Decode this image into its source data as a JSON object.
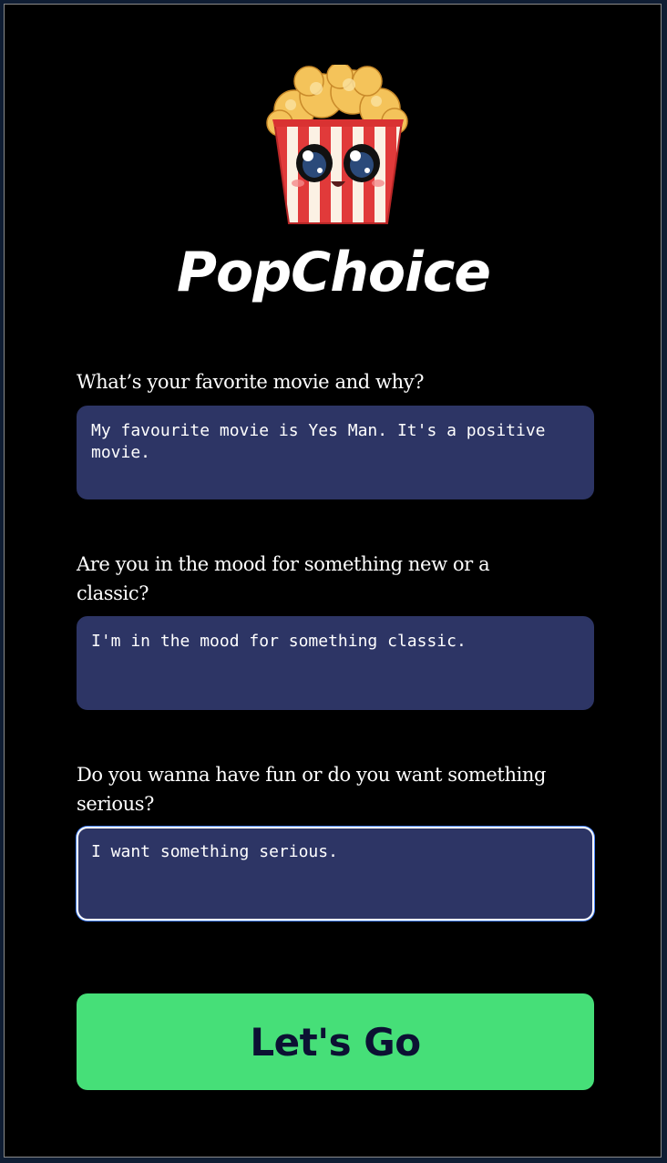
{
  "app": {
    "title": "PopChoice",
    "logo_icon": "popcorn-mascot-icon"
  },
  "form": {
    "questions": [
      {
        "label": "What’s your favorite movie and why?",
        "answer": "My favourite movie is Yes Man. It's a positive movie."
      },
      {
        "label": "Are you in the mood for something new or a classic?",
        "answer": "I'm in the mood for something classic."
      },
      {
        "label": "Do you wanna have fun or do you want something serious?",
        "answer": "I want something serious."
      }
    ],
    "submit_label": "Let's Go"
  },
  "colors": {
    "background": "#000000",
    "input_bg": "#2d3565",
    "button_bg": "#46df78",
    "button_text": "#0c1133"
  }
}
